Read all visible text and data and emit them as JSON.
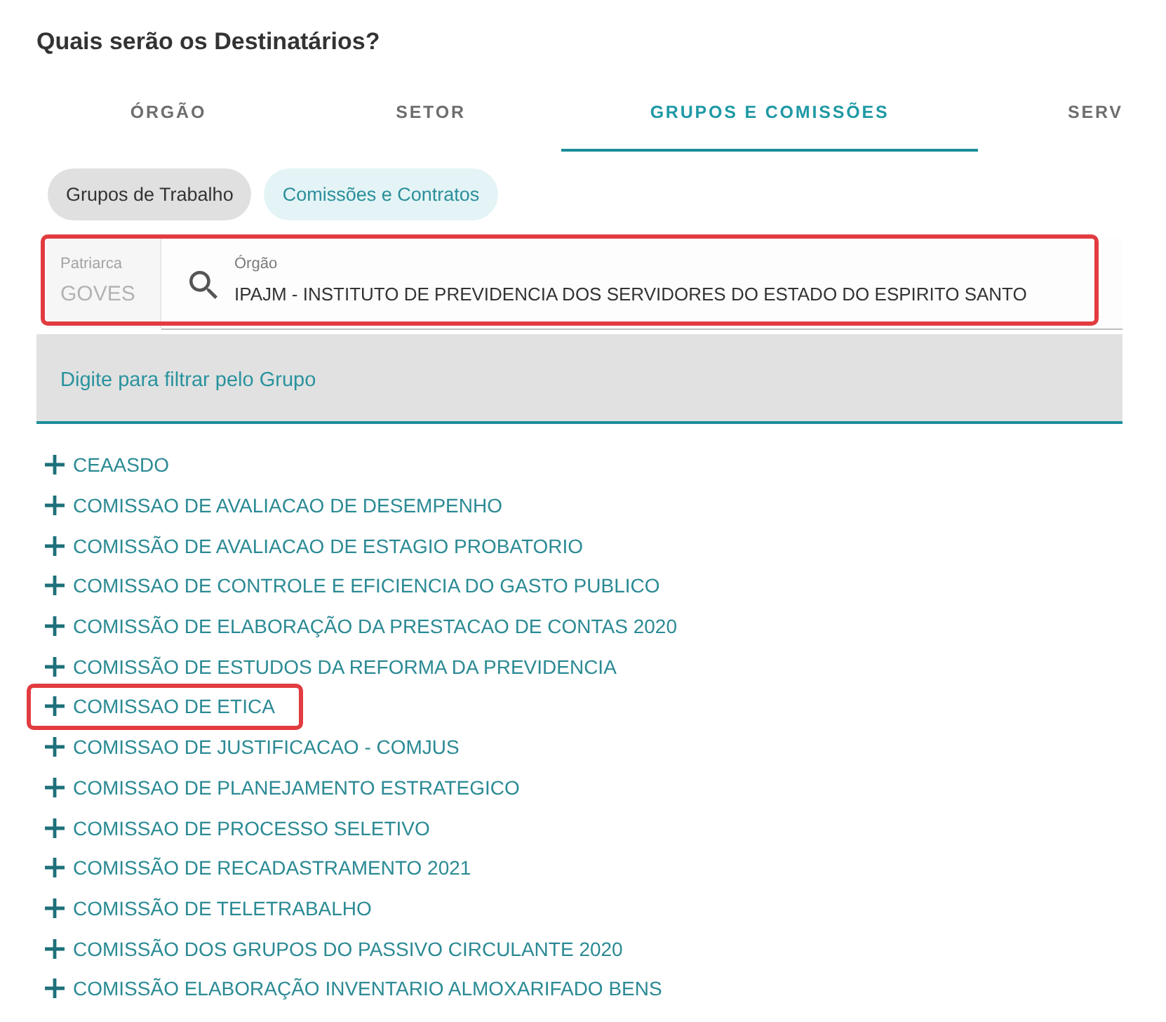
{
  "title": "Quais serão os Destinatários?",
  "tabs": [
    {
      "label": "ÓRGÃO",
      "selected": false
    },
    {
      "label": "SETOR",
      "selected": false
    },
    {
      "label": "GRUPOS E COMISSÕES",
      "selected": true
    },
    {
      "label": "SERV",
      "selected": false
    }
  ],
  "chips": [
    {
      "label": "Grupos de Trabalho",
      "selected": false
    },
    {
      "label": "Comissões e Contratos",
      "selected": true
    }
  ],
  "origin": {
    "highlighted": true,
    "patriarca": {
      "label": "Patriarca",
      "value": "GOVES",
      "disabled": true
    },
    "orgao": {
      "label": "Órgão",
      "value": "IPAJM - INSTITUTO DE PREVIDENCIA DOS SERVIDORES DO ESTADO DO ESPIRITO SANTO"
    }
  },
  "filter": {
    "placeholder": "Digite para filtrar pelo Grupo"
  },
  "groups": [
    {
      "label": "CEAASDO",
      "expanded": false,
      "highlighted": false
    },
    {
      "label": "COMISSAO DE AVALIACAO DE DESEMPENHO",
      "expanded": false,
      "highlighted": false
    },
    {
      "label": "COMISSÃO DE AVALIACAO DE ESTAGIO PROBATORIO",
      "expanded": false,
      "highlighted": false
    },
    {
      "label": "COMISSAO DE CONTROLE E EFICIENCIA DO GASTO PUBLICO",
      "expanded": false,
      "highlighted": false
    },
    {
      "label": "COMISSÃO DE ELABORAÇÃO DA PRESTACAO DE CONTAS 2020",
      "expanded": false,
      "highlighted": false
    },
    {
      "label": "COMISSÃO DE ESTUDOS DA REFORMA DA PREVIDENCIA",
      "expanded": false,
      "highlighted": false
    },
    {
      "label": "COMISSAO DE ETICA",
      "expanded": false,
      "highlighted": true
    },
    {
      "label": "COMISSAO DE JUSTIFICACAO - COMJUS",
      "expanded": false,
      "highlighted": false
    },
    {
      "label": "COMISSAO DE PLANEJAMENTO ESTRATEGICO",
      "expanded": false,
      "highlighted": false
    },
    {
      "label": "COMISSAO DE PROCESSO SELETIVO",
      "expanded": false,
      "highlighted": false
    },
    {
      "label": "COMISSÃO DE RECADASTRAMENTO 2021",
      "expanded": false,
      "highlighted": false
    },
    {
      "label": "COMISSÃO DE TELETRABALHO",
      "expanded": false,
      "highlighted": false
    },
    {
      "label": "COMISSÃO DOS GRUPOS DO PASSIVO CIRCULANTE 2020",
      "expanded": false,
      "highlighted": false
    },
    {
      "label": "COMISSÃO ELABORAÇÃO INVENTARIO ALMOXARIFADO BENS",
      "expanded": false,
      "highlighted": false
    }
  ]
}
